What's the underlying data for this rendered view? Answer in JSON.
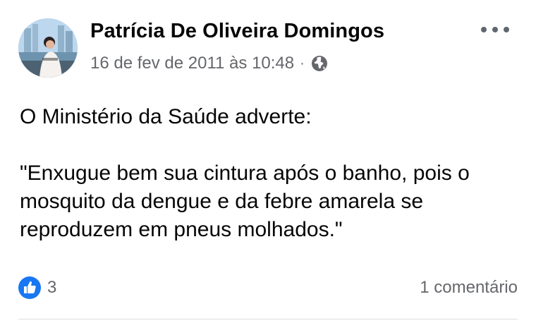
{
  "post": {
    "author": "Patrícia De Oliveira Domingos",
    "timestamp": "16 de fev de 2011 às 10:48",
    "separator": "·",
    "privacy_icon": "globe-icon",
    "more_icon": "more-options-icon",
    "text_line1": "O Ministério da Saúde adverte:",
    "text_quote": "\"Enxugue bem sua cintura após o banho, pois o mosquito da dengue e da febre amarela se reproduzem em pneus molhados.\""
  },
  "reactions": {
    "icon": "like-icon",
    "count": "3"
  },
  "comments": {
    "label": "1 comentário"
  },
  "colors": {
    "text": "#050505",
    "secondary": "#65676b",
    "like_blue": "#1877f2",
    "divider": "#dadde1"
  }
}
